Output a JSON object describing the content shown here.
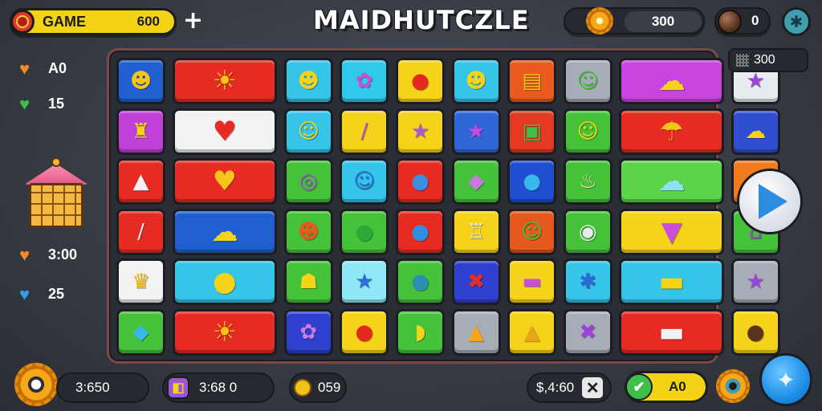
{
  "top": {
    "game_label": "GAME",
    "game_value": "600",
    "plus": "+",
    "title": "MAIDHUTCZLE",
    "coins": "300",
    "nuts": "0"
  },
  "left_stats": [
    {
      "icon": "heart-orange",
      "color": "#f08a24",
      "value": "A0"
    },
    {
      "icon": "heart-green",
      "color": "#3fbf4a",
      "value": "15"
    },
    {
      "icon": "heart-orange",
      "color": "#f08a24",
      "value": "3:00"
    },
    {
      "icon": "heart-blue",
      "color": "#2f9de8",
      "value": "25"
    }
  ],
  "right": {
    "score": "300"
  },
  "bottom": {
    "timer": "3:650",
    "moves": "3:68 0",
    "sun_count": "059",
    "combo": "$,4:60",
    "green_value": "A0"
  },
  "board": {
    "rows": [
      [
        {
          "bg": "#1f5fd0",
          "glyph": "☻",
          "fg": "#f5c51a",
          "span": 1
        },
        {
          "bg": "#e52b22",
          "glyph": "☀",
          "fg": "#f7c51a",
          "span": 2
        },
        {
          "bg": "#34c5e8",
          "glyph": "☻",
          "fg": "#f5d31a",
          "span": 1
        },
        {
          "bg": "#30c9ea",
          "glyph": "✿",
          "fg": "#c84fd8",
          "span": 1
        },
        {
          "bg": "#f5d31a",
          "glyph": "●",
          "fg": "#e5281e",
          "span": 1
        },
        {
          "bg": "#34c5e8",
          "glyph": "☻",
          "fg": "#f5d31a",
          "span": 1
        },
        {
          "bg": "#e85a1e",
          "glyph": "▤",
          "fg": "#f5c51a",
          "span": 1
        },
        {
          "bg": "#a7adb6",
          "glyph": "☺",
          "fg": "#4bc33d",
          "span": 1
        },
        {
          "bg": "#c844de",
          "glyph": "☁",
          "fg": "#f5d31a",
          "span": 2
        },
        {
          "bg": "#e8ebef",
          "glyph": "★",
          "fg": "#9b44d8",
          "span": 1
        }
      ],
      [
        {
          "bg": "#c040d8",
          "glyph": "♜",
          "fg": "#f5d31a",
          "span": 1
        },
        {
          "bg": "#f3f3f3",
          "glyph": "♥",
          "fg": "#e52b22",
          "span": 2
        },
        {
          "bg": "#34c5e8",
          "glyph": "☺",
          "fg": "#f5d31a",
          "span": 1
        },
        {
          "bg": "#f5d31a",
          "glyph": "/",
          "fg": "#b44fd8",
          "span": 1
        },
        {
          "bg": "#f5d31a",
          "glyph": "★",
          "fg": "#a45bd0",
          "span": 1
        },
        {
          "bg": "#2f66d8",
          "glyph": "★",
          "fg": "#c64ae0",
          "span": 1
        },
        {
          "bg": "#e53a22",
          "glyph": "▣",
          "fg": "#3fbf4a",
          "span": 1
        },
        {
          "bg": "#46c23a",
          "glyph": "☺",
          "fg": "#f5d31a",
          "span": 1
        },
        {
          "bg": "#e52b22",
          "glyph": "☂",
          "fg": "#f5c51a",
          "span": 2
        },
        {
          "bg": "#2f4fd0",
          "glyph": "☁",
          "fg": "#f5d31a",
          "span": 1
        }
      ],
      [
        {
          "bg": "#e52b22",
          "glyph": "▲",
          "fg": "#f3f3f3",
          "span": 1
        },
        {
          "bg": "#e52b22",
          "glyph": "♥",
          "fg": "#f5c51a",
          "span": 2
        },
        {
          "bg": "#46c23a",
          "glyph": "◎",
          "fg": "#a04fd8",
          "span": 1
        },
        {
          "bg": "#34c5e8",
          "glyph": "☺",
          "fg": "#2f66d8",
          "span": 1
        },
        {
          "bg": "#e52b22",
          "glyph": "●",
          "fg": "#3a8fe0",
          "span": 1
        },
        {
          "bg": "#46c23a",
          "glyph": "◆",
          "fg": "#c87ae0",
          "span": 1
        },
        {
          "bg": "#1f4fd0",
          "glyph": "●",
          "fg": "#39b8ec",
          "span": 1
        },
        {
          "bg": "#46c23a",
          "glyph": "♨",
          "fg": "#f2dcae",
          "span": 1
        },
        {
          "bg": "#5cd44a",
          "glyph": "☁",
          "fg": "#8fe0f5",
          "span": 2
        },
        {
          "bg": "#f07a1e",
          "glyph": "▲",
          "fg": "#3a7fe0",
          "span": 1
        }
      ],
      [
        {
          "bg": "#e52b22",
          "glyph": "/",
          "fg": "#f3f3f3",
          "span": 1
        },
        {
          "bg": "#1f5fd0",
          "glyph": "☁",
          "fg": "#f5d31a",
          "span": 2
        },
        {
          "bg": "#46c23a",
          "glyph": "☻",
          "fg": "#e5581e",
          "span": 1
        },
        {
          "bg": "#46c23a",
          "glyph": "●",
          "fg": "#2fa83a",
          "span": 1
        },
        {
          "bg": "#e52b22",
          "glyph": "●",
          "fg": "#2f8fe0",
          "span": 1
        },
        {
          "bg": "#f5d31a",
          "glyph": "♖",
          "fg": "#e8ebef",
          "span": 1
        },
        {
          "bg": "#e5581e",
          "glyph": "☺",
          "fg": "#46c23a",
          "span": 1
        },
        {
          "bg": "#46c23a",
          "glyph": "◉",
          "fg": "#e8ebef",
          "span": 1
        },
        {
          "bg": "#f5d31a",
          "glyph": "▼",
          "fg": "#c84fd8",
          "span": 2
        },
        {
          "bg": "#46c23a",
          "glyph": "⌂",
          "fg": "#9b44d8",
          "span": 1
        }
      ],
      [
        {
          "bg": "#f3f3f3",
          "glyph": "♛",
          "fg": "#f5c51a",
          "span": 1
        },
        {
          "bg": "#34c5e8",
          "glyph": "●",
          "fg": "#f5d31a",
          "span": 2
        },
        {
          "bg": "#46c23a",
          "glyph": "☗",
          "fg": "#f5d31a",
          "span": 1
        },
        {
          "bg": "#8fe8f5",
          "glyph": "★",
          "fg": "#2f6fd8",
          "span": 1
        },
        {
          "bg": "#46c23a",
          "glyph": "●",
          "fg": "#2f8fb0",
          "span": 1
        },
        {
          "bg": "#2f3fd0",
          "glyph": "✖",
          "fg": "#e52b22",
          "span": 1
        },
        {
          "bg": "#f5d31a",
          "glyph": "▬",
          "fg": "#c84fd8",
          "span": 1
        },
        {
          "bg": "#34c5e8",
          "glyph": "✱",
          "fg": "#2f66d8",
          "span": 1
        },
        {
          "bg": "#34c5e8",
          "glyph": "▬",
          "fg": "#f5d31a",
          "span": 2
        },
        {
          "bg": "#a7adb6",
          "glyph": "★",
          "fg": "#9b44d8",
          "span": 1
        }
      ],
      [
        {
          "bg": "#46c23a",
          "glyph": "◆",
          "fg": "#39b8ec",
          "span": 1
        },
        {
          "bg": "#e52b22",
          "glyph": "☀",
          "fg": "#f7c51a",
          "span": 2
        },
        {
          "bg": "#2f3fd0",
          "glyph": "✿",
          "fg": "#c87ae0",
          "span": 1
        },
        {
          "bg": "#f5d31a",
          "glyph": "●",
          "fg": "#e5281e",
          "span": 1
        },
        {
          "bg": "#46c23a",
          "glyph": "◗",
          "fg": "#f5d31a",
          "span": 1
        },
        {
          "bg": "#a7adb6",
          "glyph": "▲",
          "fg": "#f5a51a",
          "span": 1
        },
        {
          "bg": "#f5d31a",
          "glyph": "▲",
          "fg": "#e8a51a",
          "span": 1
        },
        {
          "bg": "#a7adb6",
          "glyph": "✖",
          "fg": "#9b44d8",
          "span": 1
        },
        {
          "bg": "#e52b22",
          "glyph": "▬",
          "fg": "#f3f3f3",
          "span": 2
        },
        {
          "bg": "#f5d31a",
          "glyph": "●",
          "fg": "#5b3420",
          "span": 1
        }
      ]
    ]
  }
}
